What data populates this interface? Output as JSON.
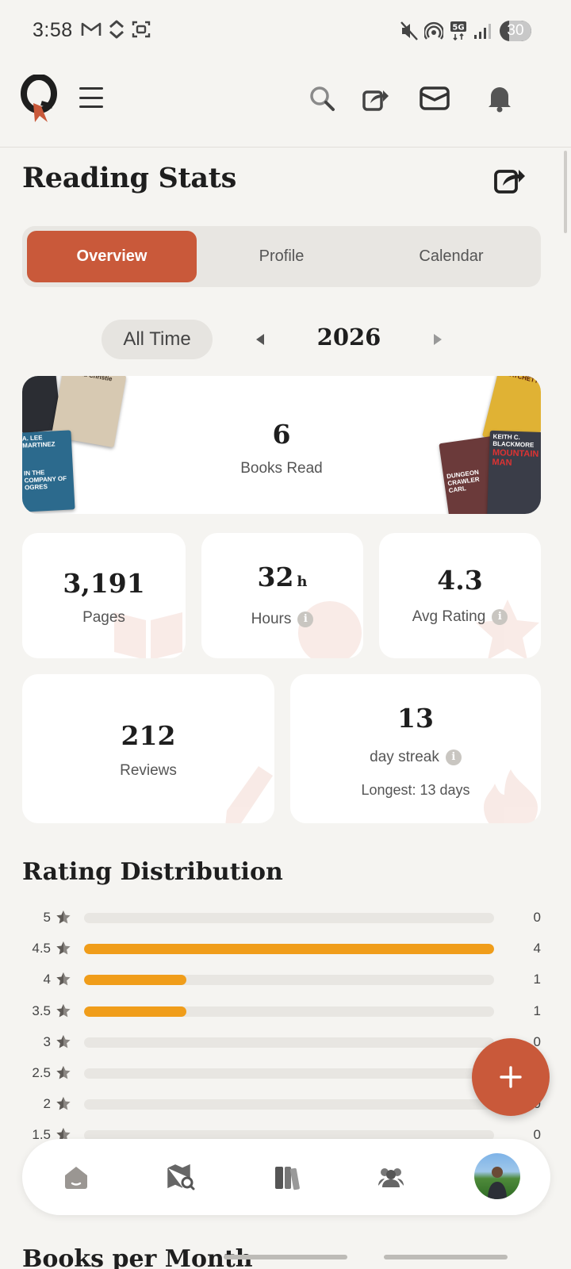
{
  "status_bar": {
    "time": "3:58",
    "battery": "30"
  },
  "header": {
    "logo_icon": "quill-logo",
    "icons": [
      "menu-icon",
      "search-icon",
      "share-icon",
      "inbox-icon",
      "bell-icon"
    ]
  },
  "page": {
    "title": "Reading Stats"
  },
  "tabs": [
    {
      "label": "Overview",
      "active": true
    },
    {
      "label": "Profile",
      "active": false
    },
    {
      "label": "Calendar",
      "active": false
    }
  ],
  "period": {
    "pill_label": "All Time",
    "year": "2026"
  },
  "books_read": {
    "value": "6",
    "label": "Books Read",
    "left_covers": [
      "Agatha Christie",
      "A. LEE MARTINEZ",
      "IN THE COMPANY OF OGRES"
    ],
    "right_covers": [
      "PRATCHETT",
      "KEITH C. BLACKMORE",
      "MOUNTAIN MAN",
      "DUNGEON CRAWLER CARL"
    ]
  },
  "stats": {
    "pages": {
      "value": "3,191",
      "label": "Pages"
    },
    "hours": {
      "value": "32",
      "unit": "h",
      "label": "Hours"
    },
    "avg_rating": {
      "value": "4.3",
      "label": "Avg Rating"
    },
    "reviews": {
      "value": "212",
      "label": "Reviews"
    },
    "streak": {
      "value": "13",
      "label": "day streak",
      "longest": "Longest: 13 days"
    }
  },
  "rating_distribution": {
    "title": "Rating Distribution",
    "max": 4,
    "rows": [
      {
        "rating": "5",
        "count": 0
      },
      {
        "rating": "4.5",
        "count": 4
      },
      {
        "rating": "4",
        "count": 1
      },
      {
        "rating": "3.5",
        "count": 1
      },
      {
        "rating": "3",
        "count": 0
      },
      {
        "rating": "2.5",
        "count": 0
      },
      {
        "rating": "2",
        "count": 0
      },
      {
        "rating": "1.5",
        "count": 0
      }
    ]
  },
  "next_section_title": "Books per Month",
  "fab": {
    "icon": "plus-icon"
  },
  "bottom_nav": [
    "home-icon",
    "map-search-icon",
    "library-icon",
    "friends-icon",
    "profile-avatar"
  ],
  "colors": {
    "accent": "#c9593a",
    "bar": "#f09d1a",
    "background": "#f5f4f1"
  }
}
